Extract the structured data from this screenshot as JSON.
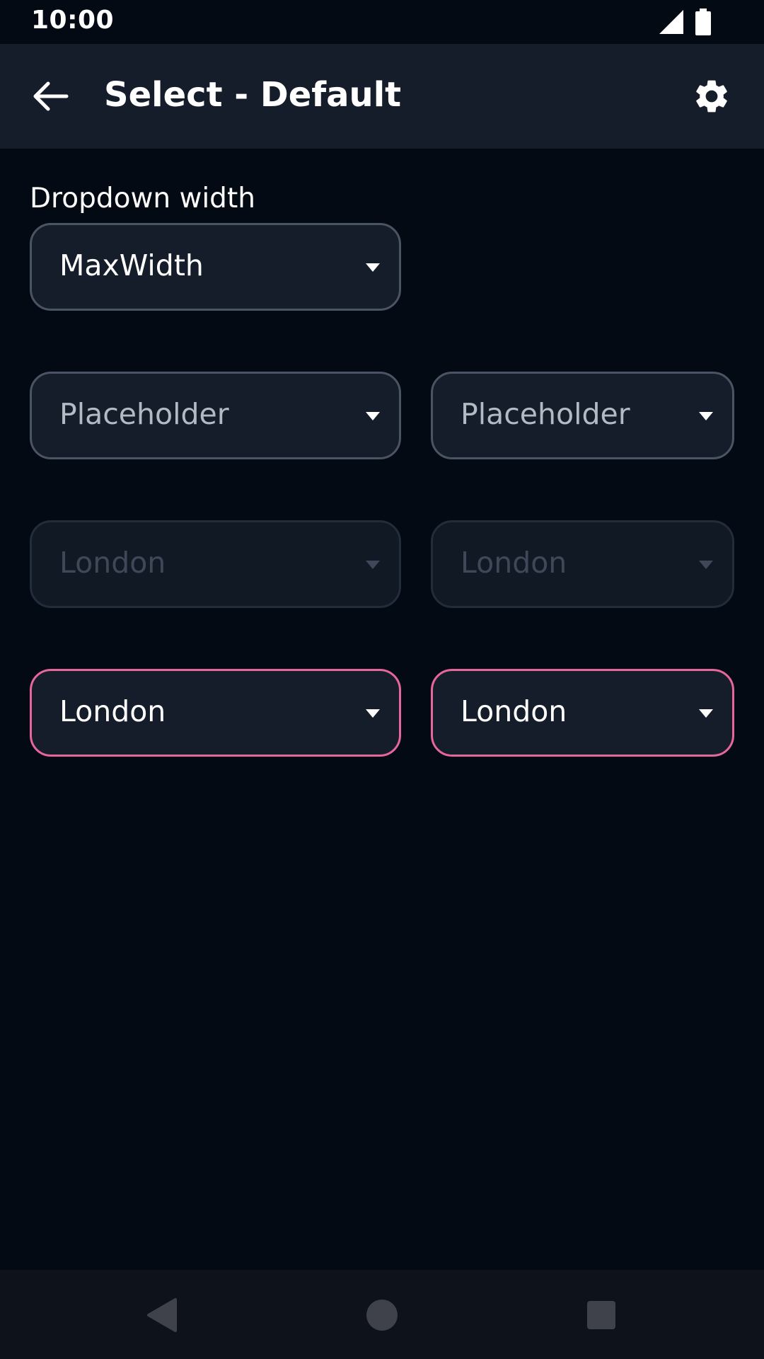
{
  "status_bar": {
    "time": "10:00"
  },
  "app_bar": {
    "title": "Select - Default",
    "back_icon": "arrow-left-icon",
    "settings_icon": "gear-icon"
  },
  "content": {
    "dropdown_width_label": "Dropdown width",
    "dropdown_width_select": {
      "value": "MaxWidth"
    },
    "placeholder_row": [
      {
        "placeholder": "Placeholder",
        "state": "placeholder"
      },
      {
        "placeholder": "Placeholder",
        "state": "placeholder"
      }
    ],
    "disabled_row": [
      {
        "value": "London",
        "state": "disabled"
      },
      {
        "value": "London",
        "state": "disabled"
      }
    ],
    "error_row": [
      {
        "value": "London",
        "state": "error"
      },
      {
        "value": "London",
        "state": "error"
      }
    ]
  },
  "colors": {
    "background": "#040a13",
    "surface": "#151d2a",
    "border": "#4a5464",
    "error_border": "#e7669e",
    "disabled_text": "#3f4858",
    "placeholder_text": "#b4bac4"
  },
  "nav_bar": {
    "back_icon": "triangle-back-icon",
    "home_icon": "circle-home-icon",
    "recents_icon": "square-recents-icon"
  }
}
